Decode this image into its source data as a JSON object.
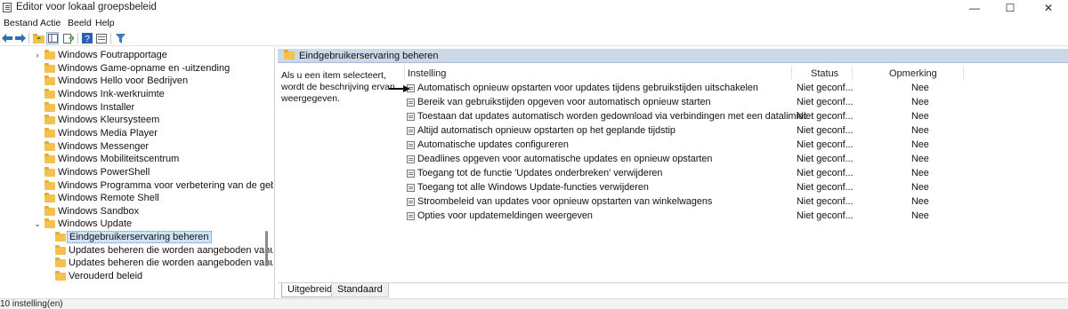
{
  "window": {
    "title": "Editor voor lokaal groepsbeleid",
    "minimize_glyph": "—",
    "maximize_glyph": "☐",
    "close_glyph": "✕"
  },
  "menu": [
    "Bestand",
    "Actie",
    "Beeld",
    "Help"
  ],
  "toolbar": {
    "icons": [
      "back-arrow-icon",
      "forward-arrow-icon",
      "up-folder-icon",
      "show-tree-icon",
      "export-icon",
      "help-icon",
      "properties-icon",
      "filter-icon"
    ]
  },
  "tree": {
    "items": [
      {
        "label": "Windows Foutrapportage",
        "indent": 1,
        "chevron": ">"
      },
      {
        "label": "Windows Game-opname en -uitzending",
        "indent": 1,
        "chevron": ""
      },
      {
        "label": "Windows Hello voor Bedrijven",
        "indent": 1,
        "chevron": ""
      },
      {
        "label": "Windows Ink-werkruimte",
        "indent": 1,
        "chevron": ""
      },
      {
        "label": "Windows Installer",
        "indent": 1,
        "chevron": ""
      },
      {
        "label": "Windows Kleursysteem",
        "indent": 1,
        "chevron": ""
      },
      {
        "label": "Windows Media Player",
        "indent": 1,
        "chevron": ""
      },
      {
        "label": "Windows Messenger",
        "indent": 1,
        "chevron": ""
      },
      {
        "label": "Windows Mobiliteitscentrum",
        "indent": 1,
        "chevron": ""
      },
      {
        "label": "Windows PowerShell",
        "indent": 1,
        "chevron": ""
      },
      {
        "label": "Windows Programma voor verbetering van de gebru",
        "indent": 1,
        "chevron": ""
      },
      {
        "label": "Windows Remote Shell",
        "indent": 1,
        "chevron": ""
      },
      {
        "label": "Windows Sandbox",
        "indent": 1,
        "chevron": ""
      },
      {
        "label": "Windows Update",
        "indent": 1,
        "chevron": "v"
      },
      {
        "label": "Eindgebruikerservaring beheren",
        "indent": 2,
        "chevron": "",
        "selected": true
      },
      {
        "label": "Updates beheren die worden aangeboden vanuit (",
        "indent": 2,
        "chevron": ""
      },
      {
        "label": "Updates beheren die worden aangeboden vanuit '",
        "indent": 2,
        "chevron": ""
      },
      {
        "label": "Verouderd beleid",
        "indent": 2,
        "chevron": ""
      }
    ]
  },
  "details": {
    "header_title": "Eindgebruikerservaring beheren",
    "description_lines": [
      "Als u een item selecteert,",
      "wordt de beschrijving ervan",
      "weergegeven."
    ],
    "columns": {
      "setting": "Instelling",
      "status": "Status",
      "comment": "Opmerking"
    },
    "settings": [
      {
        "name": "Automatisch opnieuw opstarten voor updates tijdens gebruikstijden uitschakelen",
        "status": "Niet geconf...",
        "comment": "Nee"
      },
      {
        "name": "Bereik van gebruikstijden opgeven voor automatisch opnieuw starten",
        "status": "Niet geconf...",
        "comment": "Nee"
      },
      {
        "name": "Toestaan dat updates automatisch worden gedownload via verbindingen met een datalimiet",
        "status": "Niet geconf...",
        "comment": "Nee"
      },
      {
        "name": "Altijd automatisch opnieuw opstarten op het geplande tijdstip",
        "status": "Niet geconf...",
        "comment": "Nee"
      },
      {
        "name": "Automatische updates configureren",
        "status": "Niet geconf...",
        "comment": "Nee"
      },
      {
        "name": "Deadlines opgeven voor automatische updates en opnieuw opstarten",
        "status": "Niet geconf...",
        "comment": "Nee"
      },
      {
        "name": "Toegang tot de functie 'Updates onderbreken' verwijderen",
        "status": "Niet geconf...",
        "comment": "Nee"
      },
      {
        "name": "Toegang tot alle Windows Update-functies verwijderen",
        "status": "Niet geconf...",
        "comment": "Nee"
      },
      {
        "name": "Stroombeleid van updates voor opnieuw opstarten van winkelwagens",
        "status": "Niet geconf...",
        "comment": "Nee"
      },
      {
        "name": "Opties voor updatemeldingen weergeven",
        "status": "Niet geconf...",
        "comment": "Nee"
      }
    ]
  },
  "tabs": [
    "Uitgebreid",
    "Standaard"
  ],
  "status_bar": "10 instelling(en)"
}
